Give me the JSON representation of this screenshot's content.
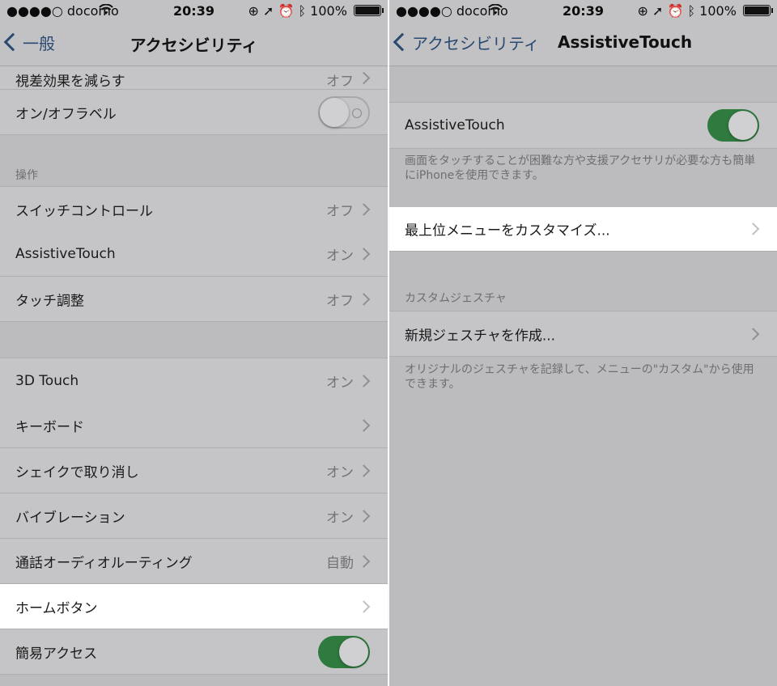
{
  "status": {
    "carrier": "●●●●○ docomo",
    "time": "20:39",
    "battery": "100%",
    "icons": [
      "wifi-icon",
      "orientation-lock-icon",
      "location-icon",
      "alarm-icon",
      "bluetooth-icon",
      "battery-icon"
    ]
  },
  "left": {
    "back_label": "一般",
    "title": "アクセシビリティ",
    "rows": {
      "reduce_motion": {
        "label": "視差効果を減らす",
        "value": "オフ"
      },
      "onoff_labels": {
        "label": "オン/オフラベル",
        "toggle": "off"
      },
      "section_header": "操作",
      "switch_control": {
        "label": "スイッチコントロール",
        "value": "オフ"
      },
      "assistive_touch": {
        "label": "AssistiveTouch",
        "value": "オン"
      },
      "touch_accommodations": {
        "label": "タッチ調整",
        "value": "オフ"
      },
      "touch_3d": {
        "label": "3D Touch",
        "value": "オン"
      },
      "keyboard": {
        "label": "キーボード",
        "value": ""
      },
      "shake_to_undo": {
        "label": "シェイクで取り消し",
        "value": "オン"
      },
      "vibration": {
        "label": "バイブレーション",
        "value": "オン"
      },
      "call_audio_routing": {
        "label": "通話オーディオルーティング",
        "value": "自動"
      },
      "home_button": {
        "label": "ホームボタン",
        "value": ""
      },
      "reachability": {
        "label": "簡易アクセス",
        "toggle": "on"
      }
    }
  },
  "right": {
    "back_label": "アクセシビリティ",
    "title": "AssistiveTouch",
    "assistive_touch_label": "AssistiveTouch",
    "assistive_touch_toggle": "on",
    "assistive_touch_footer": "画面をタッチすることが困難な方や支援アクセサリが必要な方も簡単にiPhoneを使用できます。",
    "customize_menu_label": "最上位メニューをカスタマイズ...",
    "custom_gestures_header": "カスタムジェスチャ",
    "create_gesture_label": "新規ジェスチャを作成...",
    "custom_gestures_footer": "オリジナルのジェスチャを記録して、メニューの\"カスタム\"から使用できます。"
  },
  "colors": {
    "highlight": "#ffffff",
    "toggle_on": "#2f7a3f",
    "link": "#2a4a72",
    "dim_background": "#bcbcbf"
  }
}
